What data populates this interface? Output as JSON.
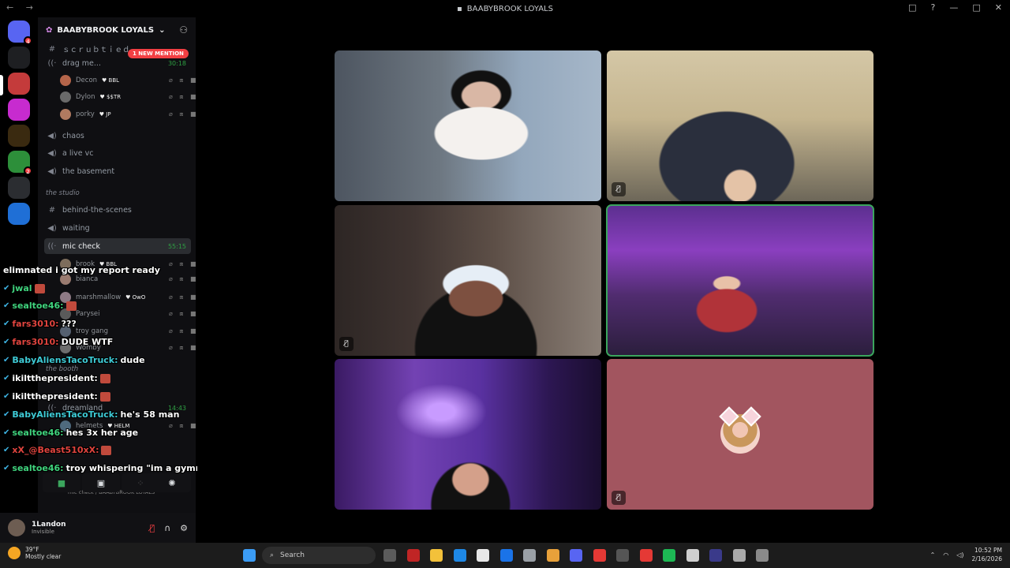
{
  "window": {
    "title": "BAABYBROOK LOYALS",
    "nav": "← →",
    "controls": [
      "□",
      "?",
      "—",
      "□",
      "✕"
    ]
  },
  "server": {
    "name": "BAABYBROOK LOYALS",
    "new_mention": "1 NEW MENTION"
  },
  "rail": [
    {
      "name": "discord-home",
      "badge": "4",
      "color": "#5865f2"
    },
    {
      "name": "folder",
      "badge": "",
      "color": "#1e1f22"
    },
    {
      "name": "server-red",
      "badge": "",
      "color": "#c43b3b"
    },
    {
      "name": "server-pink",
      "badge": "",
      "color": "#c72bcf"
    },
    {
      "name": "server-gold",
      "badge": "",
      "color": "#3a2a10"
    },
    {
      "name": "server-monkey",
      "badge": "2",
      "color": "#2d8f3a"
    },
    {
      "name": "server-goat",
      "badge": "",
      "color": "#2b2d31"
    },
    {
      "name": "server-blue",
      "badge": "",
      "color": "#1f6fd6"
    }
  ],
  "channels": [
    {
      "id": "c1",
      "label": "ｓｃｒｕｂｔｉｅｄ",
      "time": "",
      "icon": "#"
    },
    {
      "id": "c2",
      "label": "drag me...",
      "time": "30:18",
      "icon": "((·"
    },
    {
      "id": "c3",
      "label": "chaos",
      "time": "",
      "icon": "◀)"
    },
    {
      "id": "c4",
      "label": "a live vc",
      "time": "",
      "icon": "◀)"
    },
    {
      "id": "c5",
      "label": "the basement",
      "time": "",
      "icon": "◀)"
    },
    {
      "id": "c6",
      "label": "behind-the-scenes",
      "time": "",
      "icon": "#"
    },
    {
      "id": "c7",
      "label": "waiting",
      "time": "",
      "icon": "◀)"
    },
    {
      "id": "c8",
      "label": "mic check",
      "time": "55:15",
      "icon": "((·"
    },
    {
      "id": "c9",
      "label": "dreamland",
      "time": "14:43",
      "icon": "((·"
    }
  ],
  "category": "the studio",
  "category2": "the booth",
  "users": [
    {
      "name": "Decon",
      "tag": "BBL"
    },
    {
      "name": "Dylon",
      "tag": "$$TR"
    },
    {
      "name": "porky",
      "tag": "JP"
    },
    {
      "name": "brook",
      "tag": "BBL"
    },
    {
      "name": "bianca",
      "tag": ""
    },
    {
      "name": "marshmallow",
      "tag": "OwO"
    },
    {
      "name": "Parysei",
      "tag": ""
    },
    {
      "name": "troy gang",
      "tag": ""
    },
    {
      "name": "Womby",
      "tag": ""
    },
    {
      "name": "helmets",
      "tag": "HELM"
    }
  ],
  "voice": {
    "connection": "mic check / BAABYBROOK LOYALS",
    "buttons": [
      "camera",
      "screen-share",
      "activities",
      "soundboard"
    ]
  },
  "me": {
    "name": "1Landon",
    "status": "Invisible"
  },
  "chat": [
    {
      "user": "",
      "text": "elimnated i got my report ready",
      "ucolor": ""
    },
    {
      "user": "jwal",
      "text": "",
      "ucolor": "#3fd37d"
    },
    {
      "user": "sealtoe46:",
      "text": "",
      "ucolor": "#3fd37d"
    },
    {
      "user": "fars3010:",
      "text": "???",
      "ucolor": "#e0443e"
    },
    {
      "user": "fars3010:",
      "text": "DUDE WTF",
      "ucolor": "#e0443e"
    },
    {
      "user": "BabyAliensTacoTruck:",
      "text": "dude",
      "ucolor": "#3ecbd6"
    },
    {
      "user": "ikiltthepresident:",
      "text": "",
      "ucolor": "#ffffff"
    },
    {
      "user": "ikiltthepresident:",
      "text": "",
      "ucolor": "#ffffff"
    },
    {
      "user": "BabyAliensTacoTruck:",
      "text": "he's 58 man",
      "ucolor": "#3ecbd6"
    },
    {
      "user": "sealtoe46:",
      "text": "hes 3x her age",
      "ucolor": "#3fd37d"
    },
    {
      "user": "xX_@Beast510xX:",
      "text": "",
      "ucolor": "#e0443e"
    },
    {
      "user": "sealtoe46:",
      "text": "troy whispering \"im a gymnast\"",
      "ucolor": "#3fd37d"
    }
  ],
  "tiles": [
    {
      "id": "t1",
      "muted": false,
      "active": false
    },
    {
      "id": "t2",
      "muted": true,
      "active": false
    },
    {
      "id": "t3",
      "muted": true,
      "active": false
    },
    {
      "id": "t4",
      "muted": false,
      "active": true
    },
    {
      "id": "t5",
      "muted": false,
      "active": false
    },
    {
      "id": "t6",
      "muted": true,
      "active": false
    }
  ],
  "taskbar": {
    "weather_temp": "39°F",
    "weather_desc": "Mostly clear",
    "search": "Search",
    "time": "10:52 PM",
    "date": "2/16/2026"
  },
  "colors": {
    "accent": "#3ba55d",
    "mention": "#f23f43",
    "blurple": "#5865f2"
  }
}
